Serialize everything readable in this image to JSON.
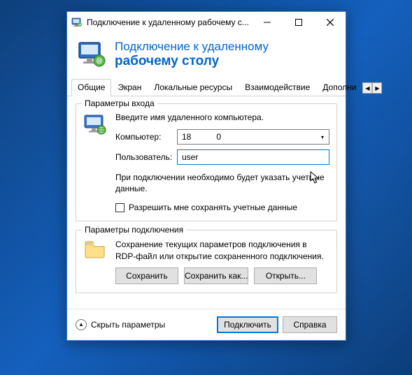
{
  "window": {
    "title": "Подключение к удаленному рабочему с..."
  },
  "header": {
    "line1": "Подключение к удаленному",
    "line2": "рабочему столу"
  },
  "tabs": {
    "items": [
      {
        "label": "Общие"
      },
      {
        "label": "Экран"
      },
      {
        "label": "Локальные ресурсы"
      },
      {
        "label": "Взаимодействие"
      },
      {
        "label": "Дополни"
      }
    ]
  },
  "login_group": {
    "title": "Параметры входа",
    "instruction": "Введите имя удаленного компьютера.",
    "computer_label": "Компьютер:",
    "computer_value_prefix": "18",
    "computer_value_suffix": "0",
    "user_label": "Пользователь:",
    "user_value": "user",
    "note": "При подключении необходимо будет указать учетные данные.",
    "remember_label": "Разрешить мне сохранять учетные данные"
  },
  "conn_group": {
    "title": "Параметры подключения",
    "text": "Сохранение текущих параметров подключения в RDP-файл или открытие сохраненного подключения.",
    "save": "Сохранить",
    "save_as": "Сохранить как...",
    "open": "Открыть..."
  },
  "footer": {
    "collapse": "Скрыть параметры",
    "connect": "Подключить",
    "help": "Справка"
  }
}
